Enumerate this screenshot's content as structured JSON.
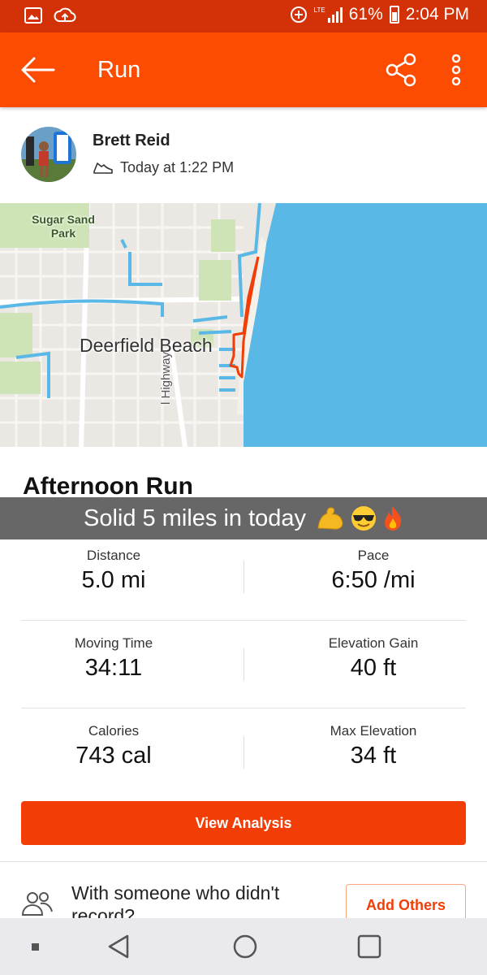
{
  "status_bar": {
    "network": "LTE",
    "battery": "61%",
    "time": "2:04 PM"
  },
  "app_bar": {
    "title": "Run"
  },
  "athlete": {
    "name": "Brett Reid",
    "time": "Today at 1:22 PM"
  },
  "map": {
    "labels": {
      "park": "Sugar Sand Park",
      "city": "Deerfield Beach",
      "road": "l Highway"
    }
  },
  "activity": {
    "title": "Afternoon Run"
  },
  "overlay": {
    "caption": "Solid 5 miles in today"
  },
  "stats": [
    {
      "label": "Distance",
      "value": "5.0 mi"
    },
    {
      "label": "Pace",
      "value": "6:50 /mi"
    },
    {
      "label": "Moving Time",
      "value": "34:11"
    },
    {
      "label": "Elevation Gain",
      "value": "40 ft"
    },
    {
      "label": "Calories",
      "value": "743 cal"
    },
    {
      "label": "Max Elevation",
      "value": "34 ft"
    }
  ],
  "actions": {
    "view_analysis": "View Analysis",
    "with_someone": "With someone who didn't record?",
    "add_others": "Add Others"
  },
  "colors": {
    "brand": "#fc4c02",
    "status_bar": "#d33208",
    "button": "#f23d07",
    "water": "#5ab8e6"
  }
}
